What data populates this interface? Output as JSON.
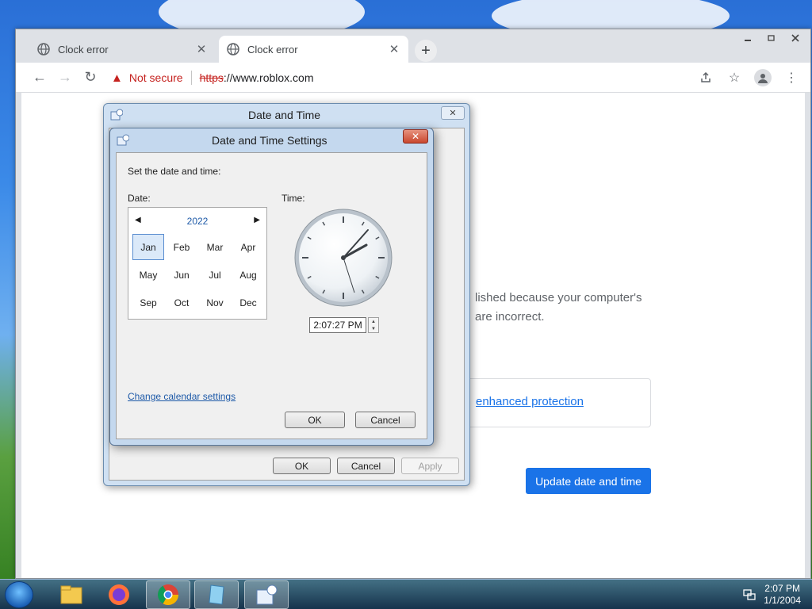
{
  "browser": {
    "tabs": [
      {
        "title": "Clock error",
        "close": "✕"
      },
      {
        "title": "Clock error",
        "close": "✕"
      }
    ],
    "new_tab": "+",
    "address": {
      "warning": "Not secure",
      "scheme": "https",
      "rest": "://www.roblox.com"
    },
    "page": {
      "message_line1": "lished because your computer's",
      "message_line2": "are incorrect.",
      "protection_link": "enhanced protection",
      "update_button": "Update date and time"
    }
  },
  "dialog_date_time": {
    "title": "Date and Time",
    "close": "✕",
    "buttons": {
      "ok": "OK",
      "cancel": "Cancel",
      "apply": "Apply"
    }
  },
  "dialog_settings": {
    "title": "Date and Time Settings",
    "close": "✕",
    "instruction": "Set the date and time:",
    "date_label": "Date:",
    "time_label": "Time:",
    "calendar": {
      "year": "2022",
      "months": [
        "Jan",
        "Feb",
        "Mar",
        "Apr",
        "May",
        "Jun",
        "Jul",
        "Aug",
        "Sep",
        "Oct",
        "Nov",
        "Dec"
      ],
      "selected_month": "Jan"
    },
    "time_value": "2:07:27 PM",
    "change_calendar_link": "Change calendar settings",
    "ok": "OK",
    "cancel": "Cancel"
  },
  "taskbar": {
    "clock_time": "2:07 PM",
    "clock_date": "1/1/2004"
  },
  "colors": {
    "accent": "#1a73e8",
    "danger": "#c5221f",
    "link": "#1e5aa8"
  }
}
